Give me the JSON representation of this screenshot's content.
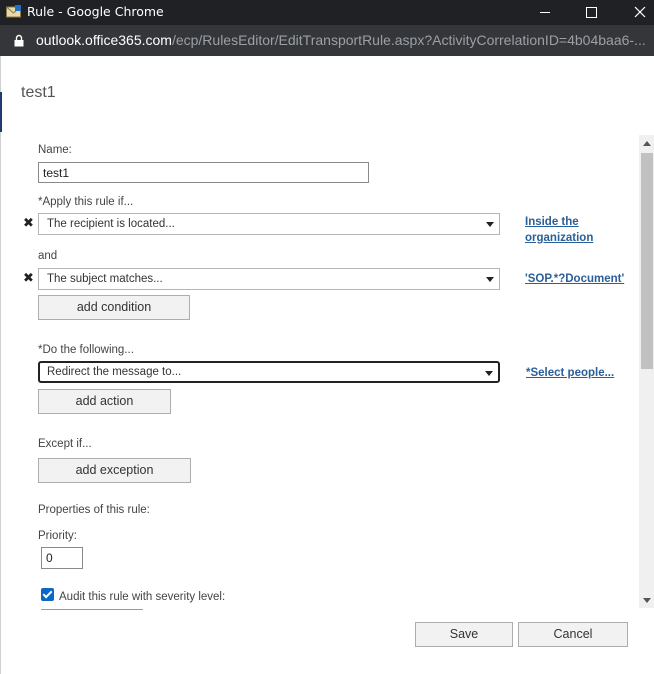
{
  "window": {
    "title": "Rule - Google Chrome",
    "controls": {
      "minimize": "—",
      "maximize": "☐",
      "close": "✕"
    }
  },
  "urlbar": {
    "host": "outlook.office365.com",
    "path": "/ecp/RulesEditor/EditTransportRule.aspx?ActivityCorrelationID=4b04baa6-..."
  },
  "page": {
    "title": "test1"
  },
  "form": {
    "name_label": "Name:",
    "name_value": "test1",
    "apply_label": "*Apply this rule if...",
    "condition1": {
      "remove": "✖",
      "value": "The recipient is located...",
      "link_line1": "Inside the",
      "link_line2": "organization"
    },
    "and_label": "and",
    "condition2": {
      "remove": "✖",
      "value": "The subject matches...",
      "link": "'SOP.*?Document'"
    },
    "add_condition": "add condition",
    "do_label": "*Do the following...",
    "action": {
      "value": "Redirect the message to...",
      "link": "*Select people..."
    },
    "add_action": "add action",
    "except_label": "Except if...",
    "add_exception": "add exception",
    "properties_label": "Properties of this rule:",
    "priority_label": "Priority:",
    "priority_value": "0",
    "audit_label": "Audit this rule with severity level:",
    "audit_checked": true
  },
  "footer": {
    "save": "Save",
    "cancel": "Cancel"
  },
  "colors": {
    "link": "#2a5f98",
    "checkbox": "#0b68c4",
    "titlebar": "#202124"
  }
}
